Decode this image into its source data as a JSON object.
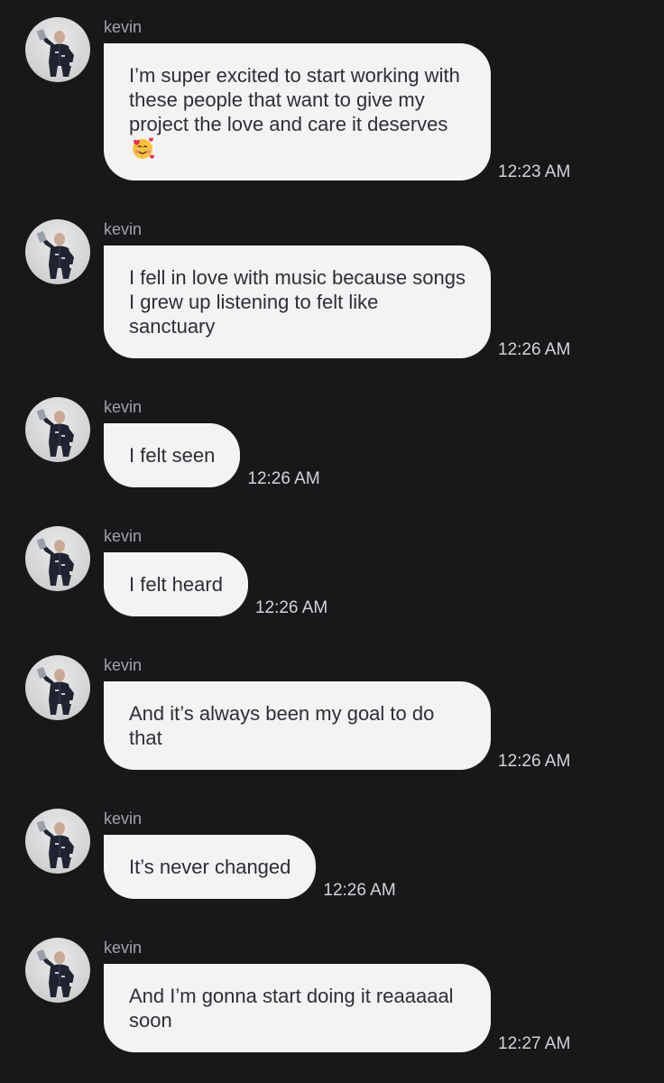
{
  "sender": "kevin",
  "messages": [
    {
      "text": "I’m super excited to start working with these people that want to give my project the love and care it deserves",
      "emoji": "smiling-face-with-hearts",
      "time": "12:23 AM"
    },
    {
      "text": "I fell in love with music because songs I grew up listening to felt like sanctuary",
      "time": "12:26 AM"
    },
    {
      "text": "I felt seen",
      "time": "12:26 AM"
    },
    {
      "text": "I felt heard",
      "time": "12:26 AM"
    },
    {
      "text": "And it’s always been my goal to do that",
      "time": "12:26 AM"
    },
    {
      "text": "It’s never changed",
      "time": "12:26 AM"
    },
    {
      "text": "And I’m gonna start doing it reaaaaal soon",
      "time": "12:27 AM"
    }
  ],
  "colors": {
    "background": "#18181b",
    "bubble": "#f3f3f5",
    "bubble_text": "#2e2e33",
    "sender_text": "#a1a1aa",
    "time_text": "#d4d4d8"
  }
}
